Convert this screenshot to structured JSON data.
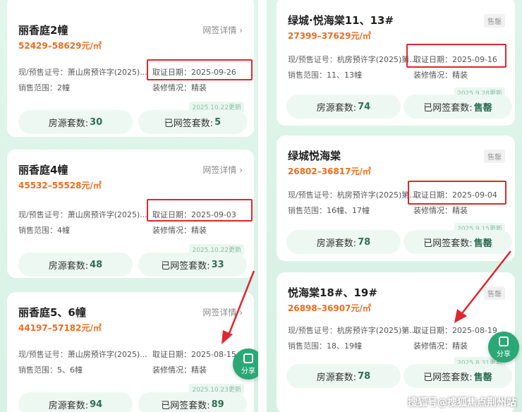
{
  "left": {
    "cards": [
      {
        "name": "丽香庭2幢",
        "price": "52429–58629元/㎡",
        "link": "网签详情 ›",
        "license_label": "现/预售证号：",
        "license_value": "萧山房预许字(2025)...",
        "date_label": "取证日期：",
        "date_value": "2025-09-26",
        "range_label": "销售范围：",
        "range_value": "2幢",
        "decor_label": "装修情况：",
        "decor_value": "精装",
        "update": "2025.10.22更新",
        "stat1_label": "房源套数:",
        "stat1_value": "30",
        "stat2_label": "已网签套数:",
        "stat2_value": "5"
      },
      {
        "name": "丽香庭4幢",
        "price": "45532–55528元/㎡",
        "link": "网签详情 ›",
        "license_label": "现/预售证号：",
        "license_value": "萧山房预许字(2025)...",
        "date_label": "取证日期：",
        "date_value": "2025-09-03",
        "range_label": "销售范围：",
        "range_value": "4幢",
        "decor_label": "装修情况：",
        "decor_value": "精装",
        "update": "2025.10.22更新",
        "stat1_label": "房源套数:",
        "stat1_value": "48",
        "stat2_label": "已网签套数:",
        "stat2_value": "33"
      },
      {
        "name": "丽香庭5、6幢",
        "price": "44197–57182元/㎡",
        "link": "网签详情 ›",
        "license_label": "现/预售证号：",
        "license_value": "萧山房预许字(2025)...",
        "date_label": "取证日期：",
        "date_value": "2025-08-15",
        "range_label": "销售范围：",
        "range_value": "5、6幢",
        "decor_label": "装修情况：",
        "decor_value": "精装",
        "update": "2025.10.23更新",
        "stat1_label": "房源套数:",
        "stat1_value": "94",
        "stat2_label": "已网签套数:",
        "stat2_value": "89"
      }
    ]
  },
  "right": {
    "cards": [
      {
        "name": "绿城·悦海棠11、13#",
        "price": "27399–37629元/㎡",
        "tag": "售罄",
        "license_label": "现/预售证号：",
        "license_value": "杭房预许字(2025)第...",
        "date_label": "取证日期：",
        "date_value": "2025-09-16",
        "range_label": "销售范围：",
        "range_value": "11、13幢",
        "decor_label": "装修情况：",
        "decor_value": "精装",
        "update": "2025.9.28更新",
        "stat1_label": "房源套数:",
        "stat1_value": "74",
        "stat2_label": "已网签套数:",
        "stat2_value": "售罄"
      },
      {
        "name": "绿城悦海棠",
        "price": "26802–36817元/㎡",
        "tag": "售罄",
        "license_label": "现/预售证号：",
        "license_value": "杭房预许字(2025)第...",
        "date_label": "取证日期：",
        "date_value": "2025-09-04",
        "range_label": "销售范围：",
        "range_value": "16幢、17幢",
        "decor_label": "装修情况：",
        "decor_value": "精装",
        "update": "2025.9.15更新",
        "stat1_label": "房源套数:",
        "stat1_value": "78",
        "stat2_label": "已网签套数:",
        "stat2_value": "售罄"
      },
      {
        "name": "悦海棠18#、19#",
        "price": "26898–36907元/㎡",
        "tag": "售罄",
        "license_label": "现/预售证号：",
        "license_value": "杭房预许字(2025)第...",
        "date_label": "取证日期：",
        "date_value": "2025-08-19",
        "range_label": "销售范围：",
        "range_value": "18、19幢",
        "decor_label": "装修情况：",
        "decor_value": "精装",
        "update": "2025.8.31更新",
        "stat1_label": "房源套数:",
        "stat1_value": "78",
        "stat2_label": "已网签套数:",
        "stat2_value": "售罄"
      }
    ]
  },
  "share_label": "分享",
  "watermark": "搜狐号@搜狐焦点荆州站",
  "colors": {
    "price": "#f06b1c",
    "highlight": "#e0262e",
    "share": "#2aa876"
  }
}
